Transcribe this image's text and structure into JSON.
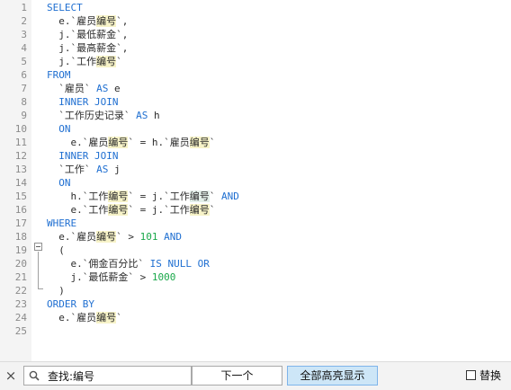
{
  "editor": {
    "line_numbers": [
      "1",
      "2",
      "3",
      "4",
      "5",
      "6",
      "7",
      "8",
      "9",
      "10",
      "11",
      "12",
      "13",
      "14",
      "15",
      "16",
      "17",
      "18",
      "19",
      "20",
      "21",
      "22",
      "23",
      "24",
      "25"
    ],
    "colors": {
      "keyword": "#1f6fd1",
      "number": "#1aa84a",
      "text": "#2b2b2b",
      "match_highlight": "#f7f3c8",
      "current_match": "#e2efe8",
      "gutter_background": "#f4f4f4",
      "line_number": "#8a8a8a"
    },
    "lines": [
      [
        {
          "t": "SELECT",
          "c": "kw"
        }
      ],
      [
        {
          "t": "  e.`雇员"
        },
        {
          "t": "编号",
          "c": "hl"
        },
        {
          "t": "`,"
        }
      ],
      [
        {
          "t": "  j.`最低薪金`,"
        }
      ],
      [
        {
          "t": "  j.`最高薪金`,"
        }
      ],
      [
        {
          "t": "  j.`工作"
        },
        {
          "t": "编号",
          "c": "hl"
        },
        {
          "t": "`"
        }
      ],
      [
        {
          "t": "FROM",
          "c": "kw"
        }
      ],
      [
        {
          "t": "  `雇员` "
        },
        {
          "t": "AS",
          "c": "kw"
        },
        {
          "t": " e"
        }
      ],
      [
        {
          "t": "  "
        },
        {
          "t": "INNER JOIN",
          "c": "kw"
        }
      ],
      [
        {
          "t": "  `工作历史记录` "
        },
        {
          "t": "AS",
          "c": "kw"
        },
        {
          "t": " h"
        }
      ],
      [
        {
          "t": "  "
        },
        {
          "t": "ON",
          "c": "kw"
        }
      ],
      [
        {
          "t": "    e.`雇员"
        },
        {
          "t": "编号",
          "c": "hl"
        },
        {
          "t": "` = h.`雇员"
        },
        {
          "t": "编号",
          "c": "hl"
        },
        {
          "t": "`"
        }
      ],
      [
        {
          "t": "  "
        },
        {
          "t": "INNER JOIN",
          "c": "kw"
        }
      ],
      [
        {
          "t": "  `工作` "
        },
        {
          "t": "AS",
          "c": "kw"
        },
        {
          "t": " j"
        }
      ],
      [
        {
          "t": "  "
        },
        {
          "t": "ON",
          "c": "kw"
        }
      ],
      [
        {
          "t": "    h.`工作"
        },
        {
          "t": "编号",
          "c": "hl"
        },
        {
          "t": "` = j.`工作"
        },
        {
          "t": "编号",
          "c": "hl2"
        },
        {
          "t": "` "
        },
        {
          "t": "AND",
          "c": "kw"
        }
      ],
      [
        {
          "t": "    e.`工作"
        },
        {
          "t": "编号",
          "c": "hl"
        },
        {
          "t": "` = j.`工作"
        },
        {
          "t": "编号",
          "c": "hl"
        },
        {
          "t": "`"
        }
      ],
      [
        {
          "t": "WHERE",
          "c": "kw"
        }
      ],
      [
        {
          "t": "  e.`雇员"
        },
        {
          "t": "编号",
          "c": "hl"
        },
        {
          "t": "` > "
        },
        {
          "t": "101",
          "c": "num"
        },
        {
          "t": " "
        },
        {
          "t": "AND",
          "c": "kw"
        }
      ],
      [
        {
          "t": "  ("
        }
      ],
      [
        {
          "t": "    e.`佣金百分比` "
        },
        {
          "t": "IS NULL OR",
          "c": "kw"
        }
      ],
      [
        {
          "t": "    j.`最低薪金` > "
        },
        {
          "t": "1000",
          "c": "num"
        }
      ],
      [
        {
          "t": "  )"
        }
      ],
      [
        {
          "t": "ORDER BY",
          "c": "kw"
        }
      ],
      [
        {
          "t": "  e.`雇员"
        },
        {
          "t": "编号",
          "c": "hl"
        },
        {
          "t": "`"
        }
      ],
      []
    ]
  },
  "findbar": {
    "close_icon": "×",
    "search_value": "查找:编号",
    "search_icon": "magnifier-icon",
    "dropdown_icon": "chevron-down-icon",
    "next_label": "下一个",
    "highlight_all_label": "全部高亮显示",
    "replace_label": "替换",
    "replace_checked": false
  }
}
